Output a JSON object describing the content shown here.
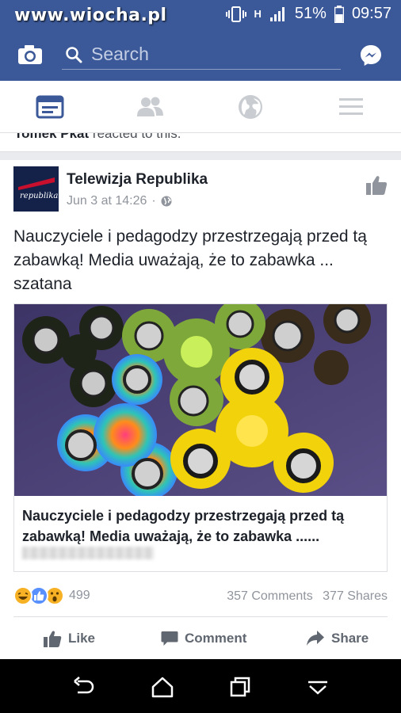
{
  "status": {
    "watermark": "www.wiocha.pl",
    "network": "H",
    "battery": "51%",
    "time": "09:57"
  },
  "topbar": {
    "search_placeholder": "Search",
    "icons": [
      "camera-icon",
      "search-icon",
      "messenger-icon"
    ]
  },
  "tabs": [
    "news-feed-icon",
    "friends-icon",
    "globe-icon",
    "menu-icon"
  ],
  "previous_story": {
    "actor": "Tomek Pkat",
    "activity": "reacted to this."
  },
  "post": {
    "page_name": "Telewizja Republika",
    "avatar_text": "republika",
    "date": "Jun 3 at 14:26",
    "privacy_separator": "·",
    "text": "Nauczyciele i pedagodzy przestrzegają przed tą zabawką! Media uważają, że to zabawka ... szatana",
    "link": {
      "title": "Nauczyciele i pedagodzy przestrzegają przed tą zabawką! Media uważają, że to zabawka ......",
      "image_alt": "fidget-spinners-photo"
    },
    "reactions": {
      "types": [
        "haha",
        "like",
        "wow"
      ],
      "count": "499"
    },
    "comments": "357 Comments",
    "shares": "377 Shares",
    "actions": {
      "like": "Like",
      "comment": "Comment",
      "share": "Share"
    }
  },
  "colors": {
    "brand": "#3b5998",
    "text": "#1d2129",
    "muted": "#90949c",
    "action": "#606770",
    "like_blue": "#5890ff",
    "haha_yellow": "#f7b125"
  }
}
